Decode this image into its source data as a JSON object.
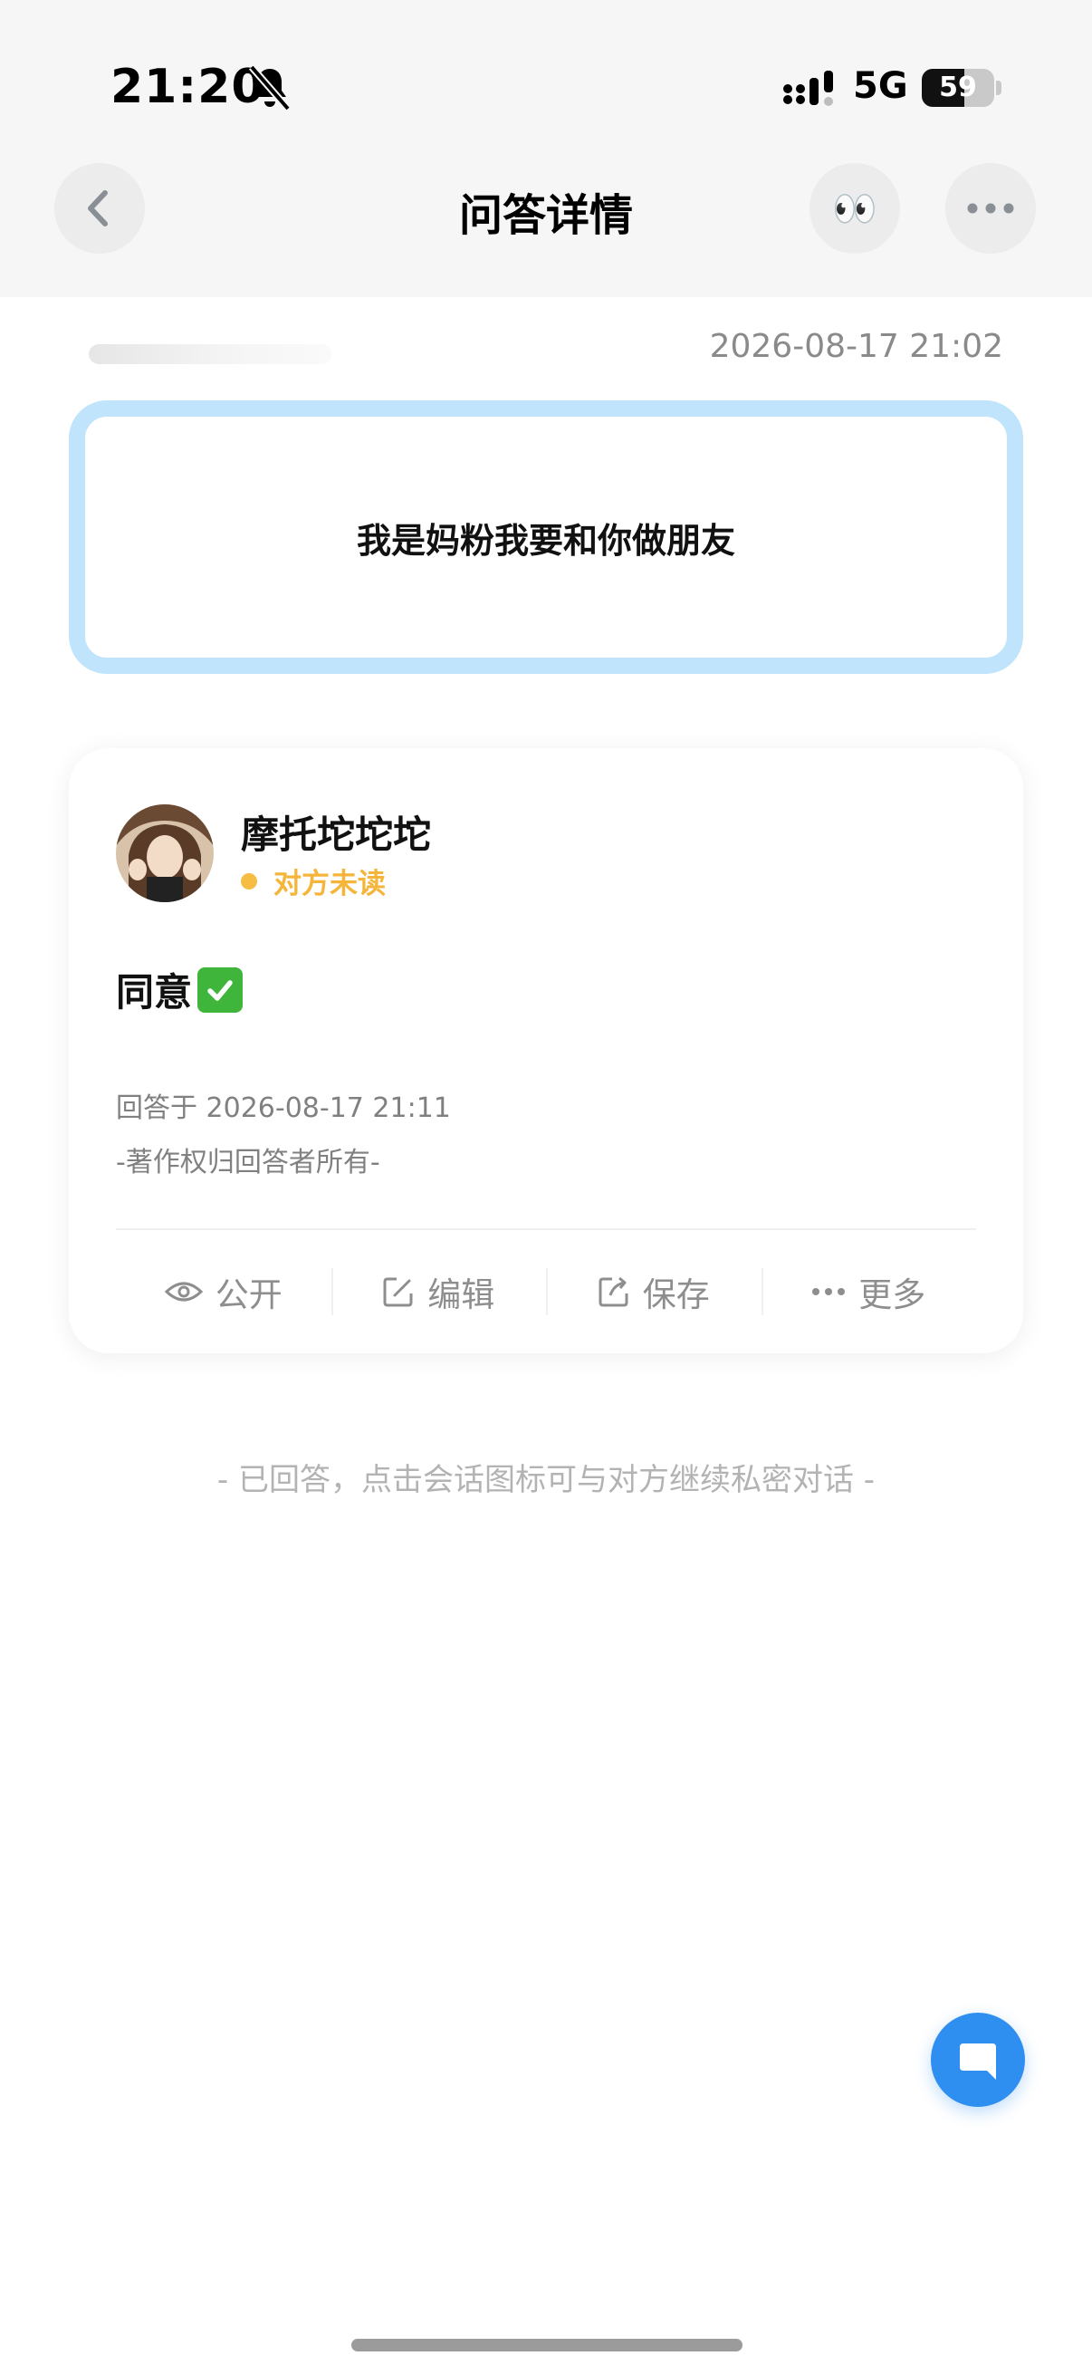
{
  "status_bar": {
    "time": "21:20",
    "network": "5G",
    "battery_level": 59,
    "battery_text": "59",
    "mute_icon": "bell-slash-icon",
    "signal_icon": "cellular-signal-icon"
  },
  "nav": {
    "title": "问答详情",
    "back_icon": "chevron-left-icon",
    "eyes_emoji": "👀",
    "more_icon": "ellipsis-icon"
  },
  "question": {
    "time": "2026-08-17 21:02",
    "text": "我是妈粉我要和你做朋友",
    "border_color": "#bfe4fb"
  },
  "answer": {
    "author_name": "摩托坨坨坨",
    "read_status": "对方未读",
    "text": "同意",
    "emoji_icon": "check-mark-button-icon",
    "answered_at": "回答于 2026-08-17 21:11",
    "copyright": "-著作权归回答者所有-"
  },
  "actions": [
    {
      "label": "公开",
      "icon": "eye-icon"
    },
    {
      "label": "编辑",
      "icon": "edit-icon"
    },
    {
      "label": "保存",
      "icon": "share-icon"
    },
    {
      "label": "更多",
      "icon": "ellipsis-icon"
    }
  ],
  "hint": "- 已回答，点击会话图标可与对方继续私密对话 -",
  "chat_button": {
    "icon": "chat-bubble-icon",
    "color": "#2f8ff0"
  },
  "colors": {
    "accent": "#2f8ff0",
    "status_yellow": "#f5b53a"
  }
}
